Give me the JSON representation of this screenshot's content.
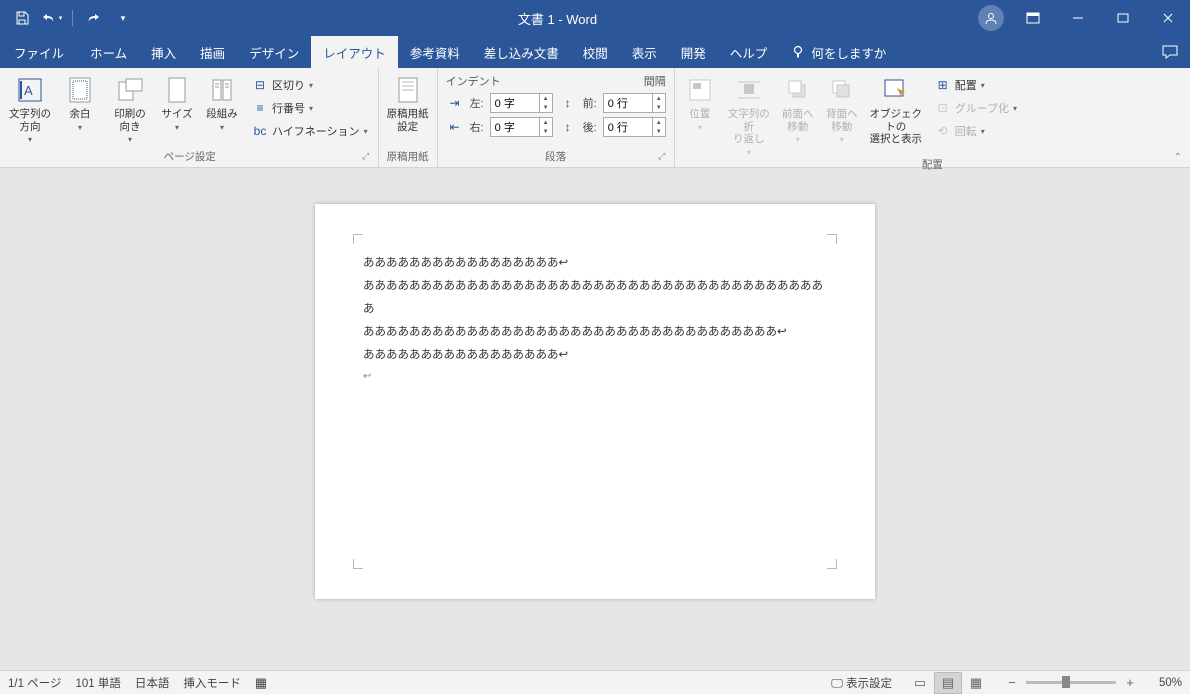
{
  "titlebar": {
    "title": "文書 1  -  Word"
  },
  "tabs": {
    "file": "ファイル",
    "items": [
      "ホーム",
      "挿入",
      "描画",
      "デザイン",
      "レイアウト",
      "参考資料",
      "差し込み文書",
      "校閲",
      "表示",
      "開発",
      "ヘルプ"
    ],
    "active_index": 4,
    "tell_me": "何をしますか"
  },
  "ribbon": {
    "page_setup": {
      "label": "ページ設定",
      "text_direction": "文字列の\n方向",
      "margins": "余白",
      "orientation": "印刷の\n向き",
      "size": "サイズ",
      "columns": "段組み",
      "breaks": "区切り",
      "line_numbers": "行番号",
      "hyphenation": "ハイフネーション"
    },
    "manuscript": {
      "label": "原稿用紙",
      "settings": "原稿用紙\n設定"
    },
    "paragraph": {
      "label": "段落",
      "indent_hdr": "インデント",
      "spacing_hdr": "間隔",
      "left_lbl": "左:",
      "right_lbl": "右:",
      "before_lbl": "前:",
      "after_lbl": "後:",
      "left_val": "0 字",
      "right_val": "0 字",
      "before_val": "0 行",
      "after_val": "0 行"
    },
    "arrange": {
      "label": "配置",
      "position": "位置",
      "wrap": "文字列の折\nり返し",
      "bring_fwd": "前面へ\n移動",
      "send_back": "背面へ\n移動",
      "selection_pane": "オブジェクトの\n選択と表示",
      "align": "配置",
      "group": "グループ化",
      "rotate": "回転"
    }
  },
  "document": {
    "lines": [
      "あああああああああああああああああ↩",
      "あああああああああああああああああああああああああああああああああああああああああ",
      "ああああああああああああああああああああああああああああああああああああ↩",
      "あああああああああああああああああ↩",
      "↩"
    ]
  },
  "statusbar": {
    "page": "1/1 ページ",
    "words": "101 単語",
    "lang": "日本語",
    "mode": "挿入モード",
    "display_settings": "表示設定",
    "zoom": "50%"
  }
}
